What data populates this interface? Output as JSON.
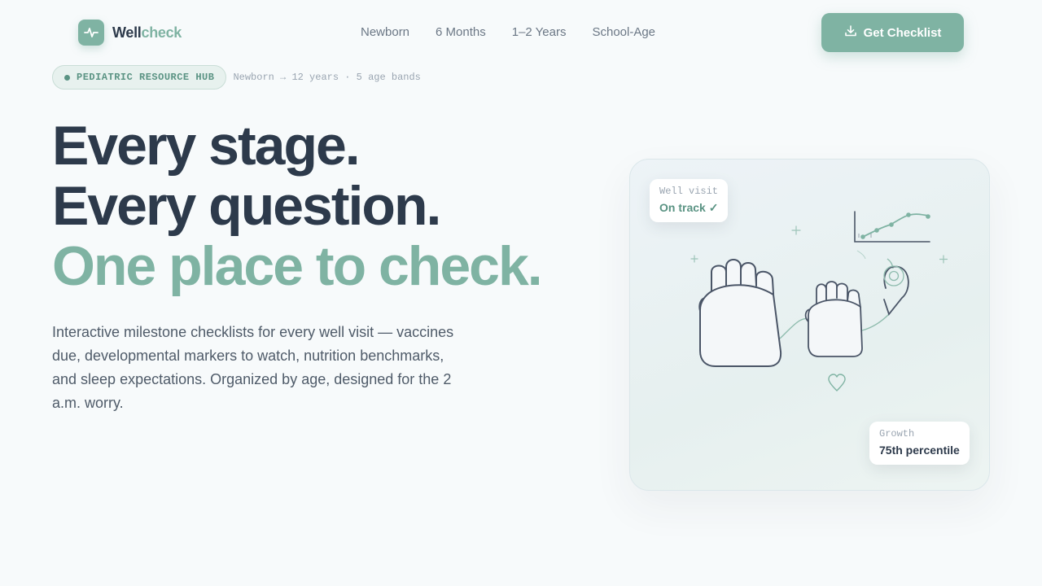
{
  "brand": {
    "name_a": "Well",
    "name_b": "check",
    "logo_icon": "pulse-icon"
  },
  "nav": {
    "items": [
      "Newborn",
      "6 Months",
      "1–2 Years",
      "School-Age"
    ]
  },
  "cta": {
    "label": "Get Checklist",
    "icon": "download-icon"
  },
  "badge": {
    "label": "PEDIATRIC RESOURCE HUB",
    "meta": "Newborn → 12 years · 5 age bands"
  },
  "hero": {
    "line1": "Every stage.",
    "line2": "Every question.",
    "line3": "One place to check.",
    "subtitle": "Interactive milestone checklists for every well visit — vaccines due, developmental markers to watch, nutrition benchmarks, and sleep expectations. Organized by age, designed for the 2 a.m. worry."
  },
  "card": {
    "visit": {
      "label": "Well visit",
      "value": "On track ✓"
    },
    "growth": {
      "label": "Growth",
      "value": "75th percentile"
    },
    "illustration": [
      "adult-hand-icon",
      "child-hand-icon",
      "growth-chart-icon",
      "heart-icon",
      "finger-icon"
    ]
  },
  "colors": {
    "accent": "#7fb3a3",
    "accent_dark": "#5a9383",
    "ink": "#2d3a4b",
    "muted": "#6b7785",
    "background": "#f7fafb"
  }
}
